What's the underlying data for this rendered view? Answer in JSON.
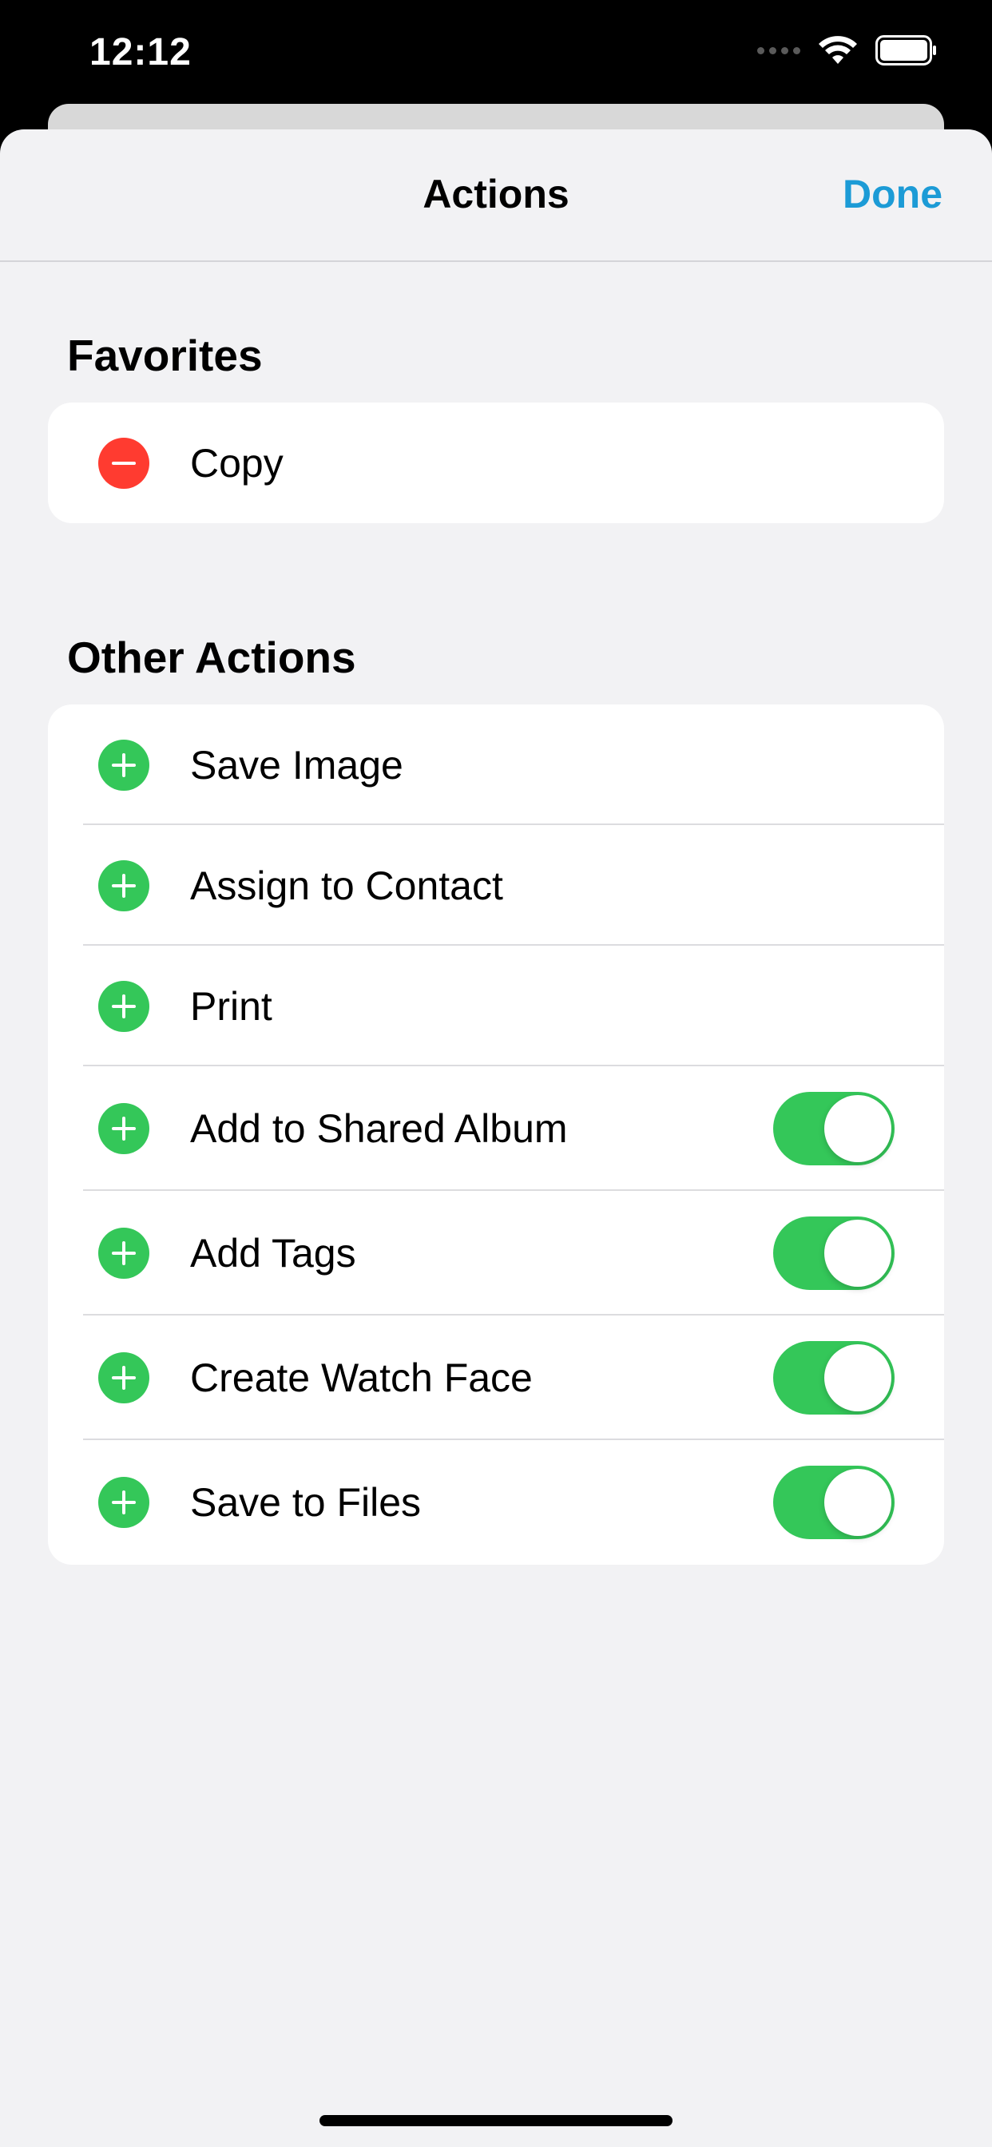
{
  "status_bar": {
    "time": "12:12",
    "icons": [
      "signal-icon",
      "wifi-icon",
      "battery-icon"
    ]
  },
  "nav": {
    "title": "Actions",
    "done_label": "Done"
  },
  "favorites": {
    "header": "Favorites",
    "items": [
      {
        "label": "Copy",
        "control": "remove"
      }
    ]
  },
  "other_actions": {
    "header": "Other Actions",
    "items": [
      {
        "label": "Save Image",
        "control": "add",
        "toggle": null
      },
      {
        "label": "Assign to Contact",
        "control": "add",
        "toggle": null
      },
      {
        "label": "Print",
        "control": "add",
        "toggle": null
      },
      {
        "label": "Add to Shared Album",
        "control": "add",
        "toggle": "on"
      },
      {
        "label": "Add Tags",
        "control": "add",
        "toggle": "on"
      },
      {
        "label": "Create Watch Face",
        "control": "add",
        "toggle": "on"
      },
      {
        "label": "Save to Files",
        "control": "add",
        "toggle": "on"
      }
    ]
  },
  "colors": {
    "accent": "#1c9bd6",
    "add": "#34c759",
    "remove": "#ff3b30",
    "toggle_on": "#34c759"
  }
}
